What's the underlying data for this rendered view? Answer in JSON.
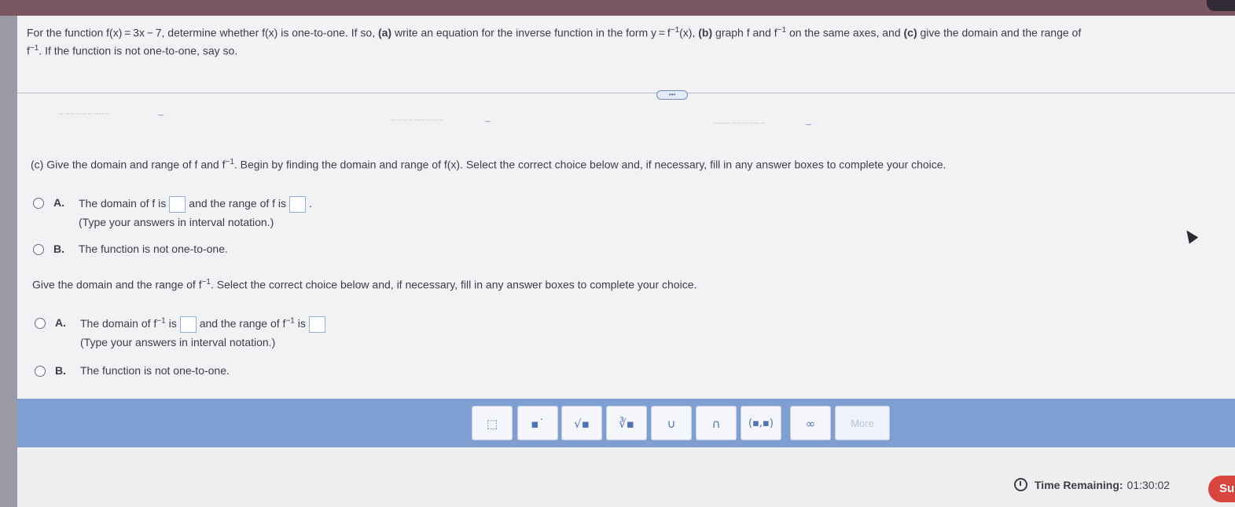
{
  "question": {
    "intro": "For the function f(x) = 3x − 7, determine whether f(x) is one-to-one. If so, ",
    "part_a_tag": "(a)",
    "part_a_text": " write an equation for the inverse function in the form y = f",
    "part_a_text2": "(x), ",
    "part_b_tag": "(b)",
    "part_b_text": " graph f and f",
    "part_b_text2": " on the same axes, and ",
    "part_c_tag": "(c)",
    "part_c_text": " give the domain and the range of",
    "line2_f": "f",
    "line2_text": ". If the function is not one-to-one, say so.",
    "exp": "−1"
  },
  "divider": {
    "handle_label": "•••"
  },
  "part_c": {
    "text_before": "(c) Give the domain and range of f and f",
    "text_after": ". Begin by finding the domain and range of f(x). Select the correct choice below and, if necessary, fill in any answer boxes to complete your choice."
  },
  "choices_f": {
    "a_letter": "A.",
    "a_text1": "The domain of f is",
    "a_text2": "and the range of f is",
    "a_text3": ".",
    "a_hint": "(Type your answers in interval notation.)",
    "b_letter": "B.",
    "b_text": "The function is not one-to-one."
  },
  "q2": {
    "text_before": "Give the domain and the range of f",
    "text_after": ". Select the correct choice below and, if necessary, fill in any answer boxes to complete your choice."
  },
  "choices_finv": {
    "a_letter": "A.",
    "a_text1": "The domain of f",
    "a_text2": " is",
    "a_text3": "and the range of f",
    "a_text4": " is",
    "a_hint": "(Type your answers in interval notation.)",
    "b_letter": "B.",
    "b_text": "The function is not one-to-one."
  },
  "toolbar": {
    "buttons": [
      {
        "name": "fraction-button",
        "symbol": "⬚"
      },
      {
        "name": "exponent-button",
        "symbol": "▪˙"
      },
      {
        "name": "sqrt-button",
        "symbol": "√▪"
      },
      {
        "name": "nth-root-button",
        "symbol": "∛▪"
      },
      {
        "name": "union-button",
        "symbol": "∪"
      },
      {
        "name": "intersection-button",
        "symbol": "∩"
      },
      {
        "name": "interval-button",
        "symbol": "(▪,▪)"
      },
      {
        "name": "infinity-button",
        "symbol": "∞"
      },
      {
        "name": "more-button",
        "symbol": "More"
      }
    ]
  },
  "footer": {
    "timer_label": "Time Remaining:",
    "timer_value": "01:30:02",
    "submit_label": "Su"
  }
}
